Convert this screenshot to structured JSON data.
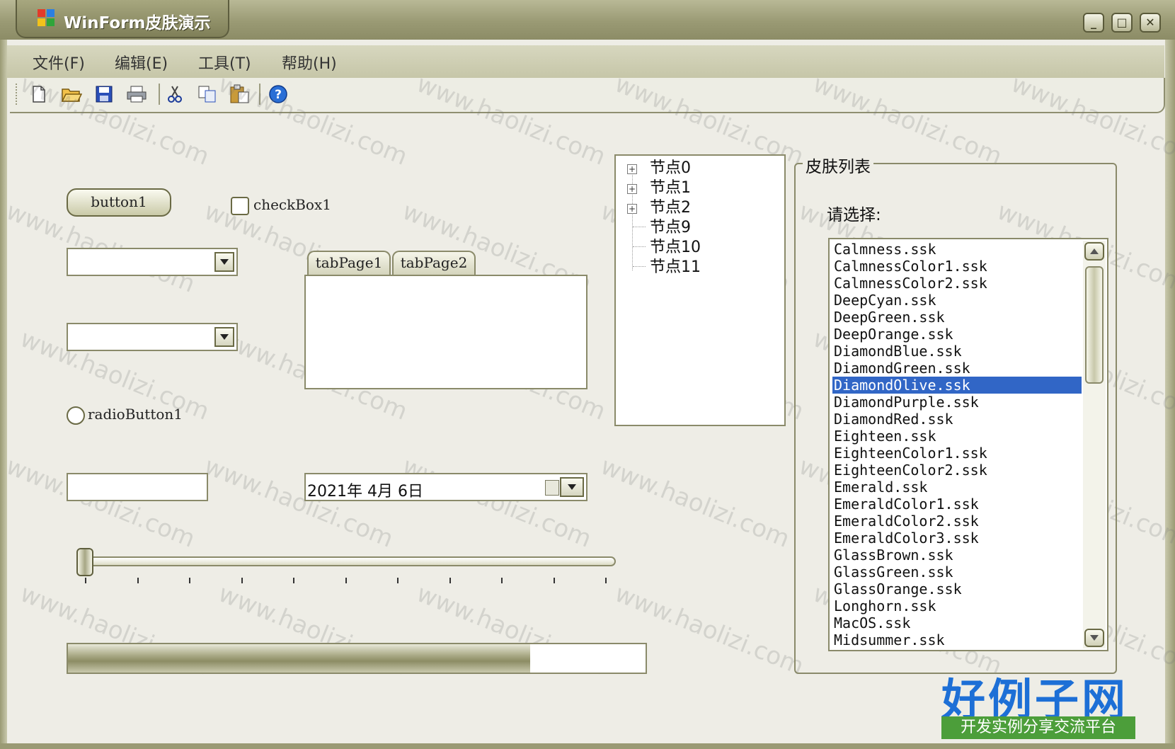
{
  "window": {
    "title": "WinForm皮肤演示",
    "controls": [
      "minimize",
      "maximize",
      "close"
    ]
  },
  "menubar": {
    "items": [
      "文件(F)",
      "编辑(E)",
      "工具(T)",
      "帮助(H)"
    ]
  },
  "toolbar": {
    "icons": [
      "new-file-icon",
      "open-folder-icon",
      "save-icon",
      "print-icon",
      "cut-icon",
      "copy-icon",
      "paste-icon",
      "help-icon"
    ]
  },
  "form": {
    "button1": "button1",
    "checkbox1": "checkBox1",
    "radio1": "radioButton1",
    "combo1_value": "",
    "combo2_value": "",
    "textbox_value": "",
    "tabs": [
      "tabPage1",
      "tabPage2"
    ],
    "date": "2021年 4月 6日",
    "slider_value": 0,
    "progress_percent": 80
  },
  "tree": {
    "nodes": [
      "节点0",
      "节点1",
      "节点2",
      "节点9",
      "节点10",
      "节点11"
    ]
  },
  "skins": {
    "group_title": "皮肤列表",
    "prompt": "请选择:",
    "selected": "DiamondOlive.ssk",
    "items": [
      "Calmness.ssk",
      "CalmnessColor1.ssk",
      "CalmnessColor2.ssk",
      "DeepCyan.ssk",
      "DeepGreen.ssk",
      "DeepOrange.ssk",
      "DiamondBlue.ssk",
      "DiamondGreen.ssk",
      "DiamondOlive.ssk",
      "DiamondPurple.ssk",
      "DiamondRed.ssk",
      "Eighteen.ssk",
      "EighteenColor1.ssk",
      "EighteenColor2.ssk",
      "Emerald.ssk",
      "EmeraldColor1.ssk",
      "EmeraldColor2.ssk",
      "EmeraldColor3.ssk",
      "GlassBrown.ssk",
      "GlassGreen.ssk",
      "GlassOrange.ssk",
      "Longhorn.ssk",
      "MacOS.ssk",
      "Midsummer.ssk"
    ]
  },
  "watermark": "www.haolizi.com",
  "brand": {
    "name": "好例子网",
    "tagline": "开发实例分享交流平台"
  },
  "colors": {
    "titlebar": "#9a9a74",
    "selection": "#3166c6",
    "brand_blue": "#1d6fd6",
    "brand_green": "#4c9e3a"
  }
}
